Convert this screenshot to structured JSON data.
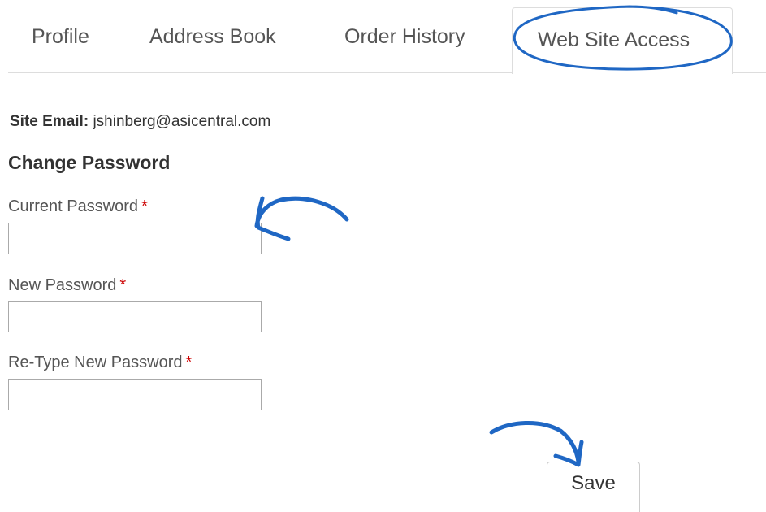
{
  "tabs": [
    {
      "label": "Profile",
      "active": false
    },
    {
      "label": "Address Book",
      "active": false
    },
    {
      "label": "Order History",
      "active": false
    },
    {
      "label": "Web Site Access",
      "active": true
    }
  ],
  "site_email": {
    "label": "Site Email:",
    "value": "jshinberg@asicentral.com"
  },
  "change_password": {
    "title": "Change Password",
    "required_marker": "*",
    "current_password": {
      "label": "Current Password",
      "value": ""
    },
    "new_password": {
      "label": "New Password",
      "value": ""
    },
    "retype_password": {
      "label": "Re-Type New Password",
      "value": ""
    }
  },
  "save_label": "Save",
  "colors": {
    "annotation": "#1f67c4",
    "required": "#cc0000",
    "border": "#dddddd"
  }
}
